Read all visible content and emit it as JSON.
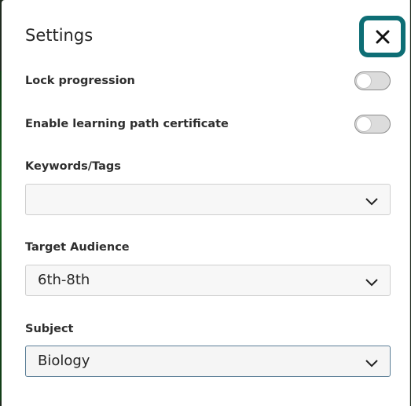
{
  "dialog": {
    "title": "Settings",
    "close_icon": "close-icon"
  },
  "toggles": [
    {
      "label": "Lock progression",
      "enabled": false
    },
    {
      "label": "Enable learning path certificate",
      "enabled": false
    }
  ],
  "fields": {
    "keywords": {
      "label": "Keywords/Tags",
      "value": ""
    },
    "target_audience": {
      "label": "Target Audience",
      "value": "6th-8th"
    },
    "subject": {
      "label": "Subject",
      "value": "Biology"
    }
  },
  "colors": {
    "close_border": "#0e6e75",
    "text": "#262626",
    "toggle_off": "#dcdcdc",
    "active_border": "#5a7d96"
  }
}
